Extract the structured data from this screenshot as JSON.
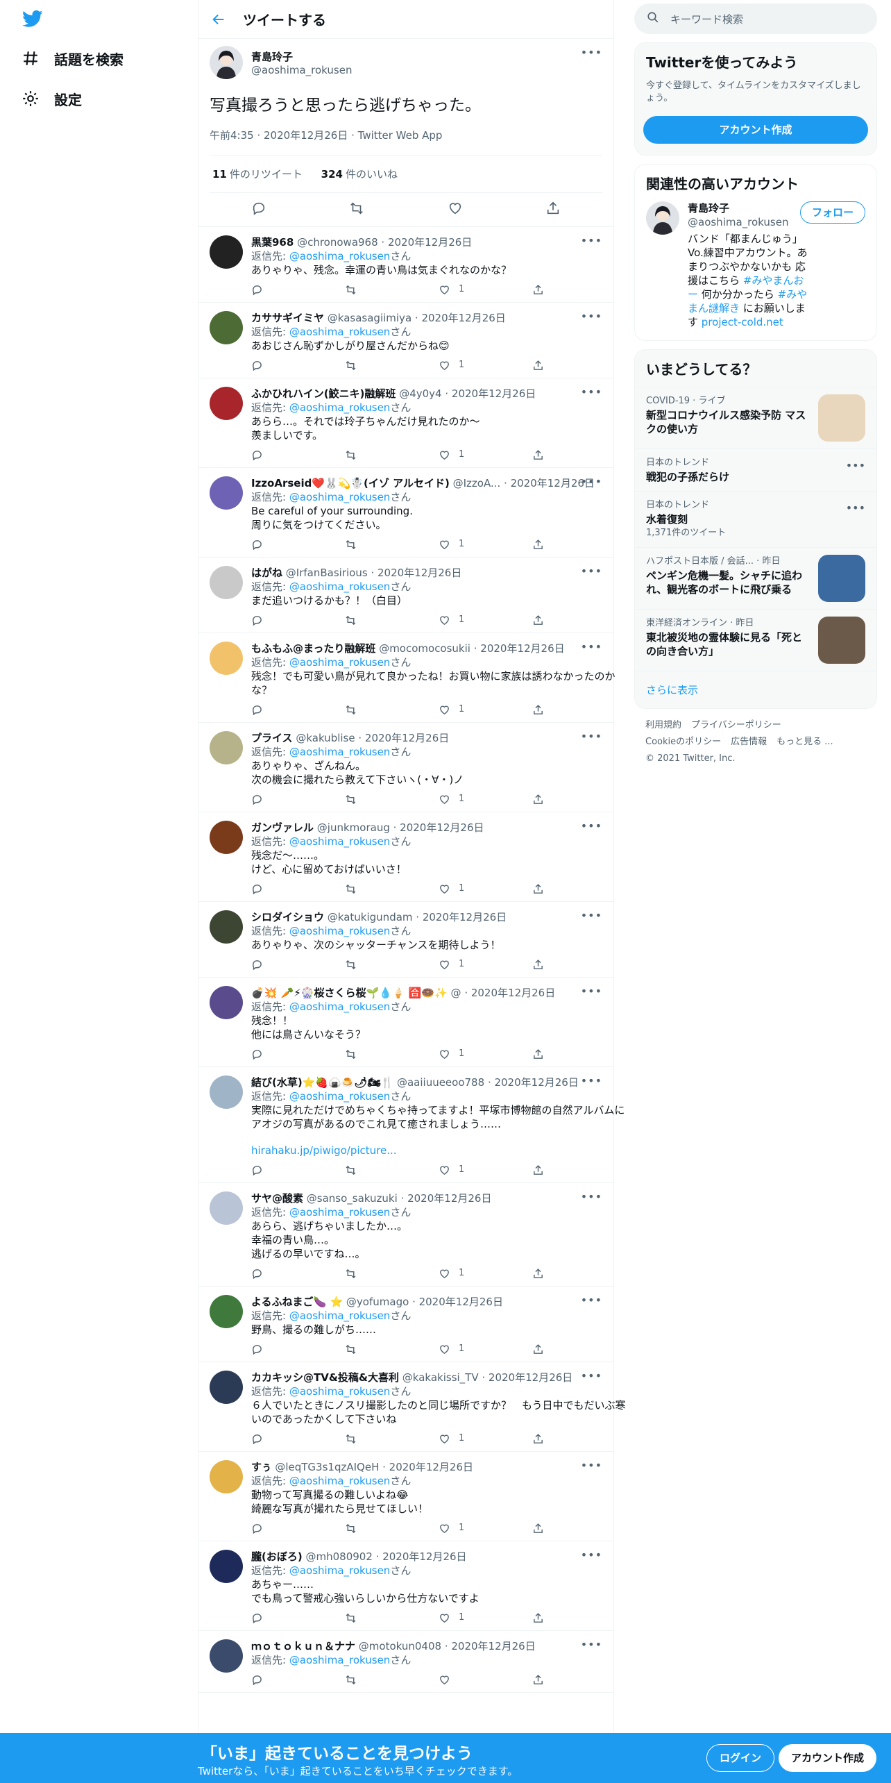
{
  "nav": {
    "explore": "話題を検索",
    "settings": "設定"
  },
  "header": {
    "title": "ツイートする"
  },
  "tweet": {
    "name": "青島玲子",
    "handle": "@aoshima_rokusen",
    "text": "写真撮ろうと思ったら逃げちゃった。",
    "meta": "午前4:35 · 2020年12月26日 · Twitter Web App",
    "retweets_count": "11",
    "retweets_label": "件のリツイート",
    "likes_count": "324",
    "likes_label": "件のいいね"
  },
  "reply_to_label": "返信先:",
  "reply_to_handle": "@aoshima_rokusen",
  "reply_to_suffix": "さん",
  "replies": [
    {
      "name": "黒葉968",
      "handle": "@chronowa968",
      "date": "· 2020年12月26日",
      "text": "ありゃりゃ、残念。幸運の青い鳥は気まぐれなのかな？",
      "likes": "1",
      "avatar_color": "#222222"
    },
    {
      "name": "カササギイミヤ",
      "handle": "@kasasagiimiya",
      "date": "· 2020年12月26日",
      "text": "あおじさん恥ずかしがり屋さんだからね😊",
      "likes": "1",
      "avatar_color": "#4d6b34"
    },
    {
      "name": "ふかひれハイン(鮫ニキ)融解班",
      "handle": "@4y0y4",
      "date": "· 2020年12月26日",
      "text": "あらら…。それでは玲子ちゃんだけ見れたのか〜\n羨ましいです。",
      "likes": "1",
      "avatar_color": "#a8262b"
    },
    {
      "name": "IzzoArseid❤️🐰💫☃️(イゾ アルセイド)",
      "handle": "@IzzoA...",
      "date": "· 2020年12月26日",
      "text": "Be careful of your surrounding.\n周りに気をつけてください。",
      "likes": "1",
      "avatar_color": "#6e62b5"
    },
    {
      "name": "はがね",
      "handle": "@IrfanBasirious",
      "date": "· 2020年12月26日",
      "text": "まだ追いつけるかも？！（白目）",
      "likes": "1",
      "avatar_color": "#c9c9c9"
    },
    {
      "name": "もふもふ@まったり融解班",
      "handle": "@mocomocosukii",
      "date": "· 2020年12月26日",
      "text": "残念！でも可愛い鳥が見れて良かったね！お買い物に家族は誘わなかったのかな？",
      "likes": "1",
      "avatar_color": "#f2c26b"
    },
    {
      "name": "プライス",
      "handle": "@kakublise",
      "date": "· 2020年12月26日",
      "text": "ありゃりゃ、ざんねん。\n次の機会に撮れたら教えて下さいヽ(・∀・)ノ",
      "likes": "1",
      "avatar_color": "#b6b38a"
    },
    {
      "name": "ガンヴァレル",
      "handle": "@junkmoraug",
      "date": "· 2020年12月26日",
      "text": "残念だ〜……。\nけど、心に留めておけばいいさ！",
      "likes": "1",
      "avatar_color": "#7a3b1b"
    },
    {
      "name": "シロダイショウ",
      "handle": "@katukigundam",
      "date": "· 2020年12月26日",
      "text": "ありゃりゃ、次のシャッターチャンスを期待しよう！",
      "likes": "1",
      "avatar_color": "#3d4533"
    },
    {
      "name": "💣💥 🥕⚡🎡桜さくら桜🌱💧🍦 🈴🍩✨",
      "handle": "@",
      "date": "· 2020年12月26日",
      "text": "残念！！\n他には鳥さんいなそう？",
      "likes": "1",
      "avatar_color": "#5a4c8c"
    },
    {
      "name": "結び(水草)⭐🍓🍙🍮🌶🏍🍴",
      "handle": "@aaiiuueeoo788",
      "date": "· 2020年12月26日",
      "text": "実際に見れただけでめちゃくちゃ持ってますよ！平塚市博物館の自然アルバムにアオジの写真があるのでこれ見て癒されましょう……",
      "link": "hirahaku.jp/piwigo/picture...",
      "likes": "1",
      "avatar_color": "#9fb4c7"
    },
    {
      "name": "サヤ@酸素",
      "handle": "@sanso_sakuzuki",
      "date": "· 2020年12月26日",
      "text": "あらら、逃げちゃいましたか…。\n幸福の青い鳥…。\n逃げるの早いですね…。",
      "likes": "1",
      "avatar_color": "#b9c4d6"
    },
    {
      "name": "よるふねまご🍆 ⭐",
      "handle": "@yofumago",
      "date": "· 2020年12月26日",
      "text": "野鳥、撮るの難しがち……",
      "likes": "1",
      "avatar_color": "#3f7a3c"
    },
    {
      "name": "カカキッシ@TV&投稿&大喜利",
      "handle": "@kakakissi_TV",
      "date": "· 2020年12月26日",
      "text": "６人でいたときにノスリ撮影したのと同じ場所ですか？　もう日中でもだいぶ寒いのであったかくして下さいね",
      "likes": "1",
      "avatar_color": "#2b3a55"
    },
    {
      "name": "すぅ",
      "handle": "@leqTG3s1qzAIQeH",
      "date": "· 2020年12月26日",
      "text": "動物って写真撮るの難しいよね😂\n綺麗な写真が撮れたら見せてほしい！",
      "likes": "1",
      "avatar_color": "#e3b34a"
    },
    {
      "name": "朧(おぼろ)",
      "handle": "@mh080902",
      "date": "· 2020年12月26日",
      "text": "あちゃー……\nでも鳥って警戒心強いらしいから仕方ないですよ",
      "likes": "1",
      "avatar_color": "#1e2a5a"
    },
    {
      "name": "ｍｏｔｏｋｕｎ＆ナナ",
      "handle": "@motokun0408",
      "date": "· 2020年12月26日",
      "text": "",
      "likes": "",
      "avatar_color": "#3b4b6b"
    }
  ],
  "right": {
    "search_placeholder": "キーワード検索",
    "join_title": "Twitterを使ってみよう",
    "join_desc": "今すぐ登録して、タイムラインをカスタマイズしましょう。",
    "join_button": "アカウント作成",
    "related_title": "関連性の高いアカウント",
    "related_name": "青島玲子",
    "related_handle": "@aoshima_rokusen",
    "follow_button": "フォロー",
    "related_bio_1": "バンド「都まんじゅう」Vo.練習中アカウント。あまりつぶやかないかも 応援はこちら",
    "related_bio_tag1": "#みやまんおー",
    "related_bio_2": "何か分かったら",
    "related_bio_tag2": "#みやまん謎解き",
    "related_bio_3": "にお願いします",
    "related_bio_link": "project-cold.net",
    "trends_title": "いまどうしてる？",
    "trends": [
      {
        "context": "COVID-19 · ライブ",
        "title": "新型コロナウイルス感染予防 マスクの使い方",
        "count": "",
        "thumb": "#e9d7bd"
      },
      {
        "context": "日本のトレンド",
        "title": "戦犯の子孫だらけ",
        "count": "",
        "thumb": ""
      },
      {
        "context": "日本のトレンド",
        "title": "水着復刻",
        "count": "1,371件のツイート",
        "thumb": ""
      },
      {
        "context": "ハフポスト日本版 / 会話... · 昨日",
        "title": "ペンギン危機一髪。シャチに追われ、観光客のボートに飛び乗る",
        "count": "",
        "thumb": "#3a6aa0"
      },
      {
        "context": "東洋経済オンライン · 昨日",
        "title": "東北被災地の霊体験に見る「死との向き合い方」",
        "count": "",
        "thumb": "#6b5a4a"
      }
    ],
    "show_more": "さらに表示",
    "footer": [
      "利用規約",
      "プライバシーポリシー",
      "Cookieのポリシー",
      "広告情報",
      "もっと見る ...",
      "© 2021 Twitter, Inc."
    ]
  },
  "bottom": {
    "title": "「いま」起きていることを見つけよう",
    "subtitle": "Twitterなら、「いま」起きていることをいち早くチェックできます。",
    "login": "ログイン",
    "signup": "アカウント作成"
  },
  "colors": {
    "accent": "#1d9bf0",
    "text": "#0f1419",
    "muted": "#536471",
    "border": "#eff3f4"
  }
}
